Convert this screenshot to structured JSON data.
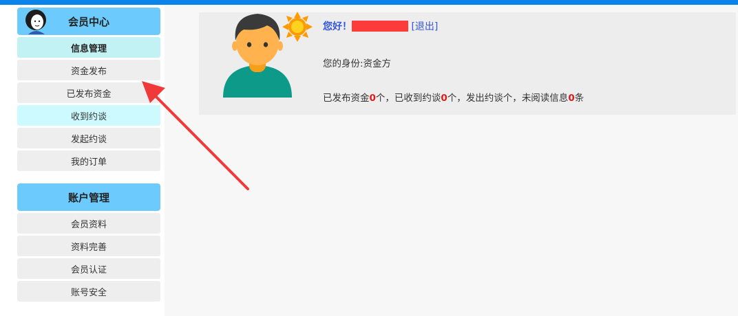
{
  "sidebar": {
    "member_center": {
      "title": "会员中心",
      "items": [
        "信息管理",
        "资金发布",
        "已发布资金",
        "收到约谈",
        "发起约谈",
        "我的订单"
      ]
    },
    "account_management": {
      "title": "账户管理",
      "items": [
        "会员资料",
        "资料完善",
        "会员认证",
        "账号安全"
      ]
    }
  },
  "profile": {
    "greeting": "您好！",
    "logout": "[退出]",
    "role": "您的身份:资金方",
    "stats": {
      "published_prefix": "已发布资金",
      "published_count": "0",
      "published_unit": "个，",
      "received_prefix": "已收到约谈",
      "received_count": "0",
      "received_unit": "个，",
      "initiated_text": "发出约谈个，",
      "unread_prefix": "未阅读信息",
      "unread_count": "0",
      "unread_unit": "条"
    }
  },
  "icons": {
    "small_avatar": "woman-avatar-icon",
    "user_avatar": "man-avatar-icon",
    "sun": "sun-icon",
    "annotation": "red-arrow"
  },
  "colors": {
    "topbar": "#0a84ea",
    "section_header": "#6ccbfc",
    "active_item": "#c3f2f5",
    "link": "#3355dd",
    "count": "#e01b1b",
    "redaction": "#fe3b3b"
  }
}
